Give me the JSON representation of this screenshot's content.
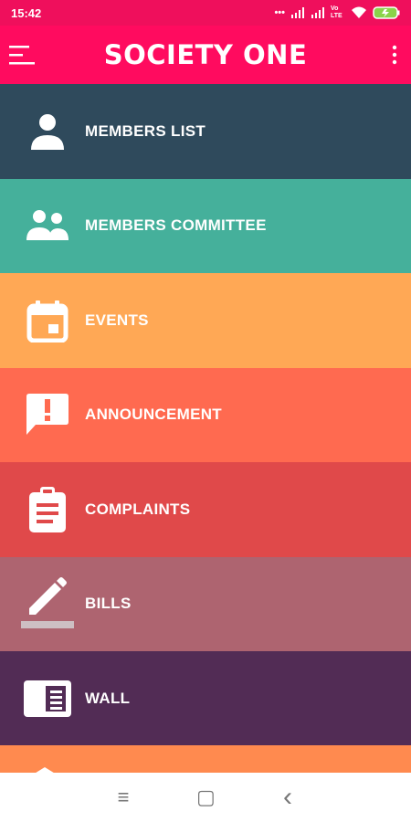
{
  "status": {
    "time": "15:42",
    "dots": "•••",
    "volte": "Vo LTE"
  },
  "app": {
    "title": "SOCIETY ONE"
  },
  "menu": [
    {
      "label": "MEMBERS LIST",
      "color": "#2f4a5c",
      "icon": "person-icon"
    },
    {
      "label": "MEMBERS COMMITTEE",
      "color": "#45b09b",
      "icon": "group-icon"
    },
    {
      "label": "EVENTS",
      "color": "#ffa855",
      "icon": "calendar-icon"
    },
    {
      "label": "ANNOUNCEMENT",
      "color": "#ff6a50",
      "icon": "announcement-icon"
    },
    {
      "label": "COMPLAINTS",
      "color": "#e0494a",
      "icon": "clipboard-icon"
    },
    {
      "label": "BILLS",
      "color": "#ae6470",
      "icon": "pencil-icon"
    },
    {
      "label": "WALL",
      "color": "#522c55",
      "icon": "wall-icon"
    }
  ],
  "colors": {
    "accent": "#ff0b5f",
    "peek": "#ff8a4f"
  },
  "nav": {
    "recent_icon": "≡",
    "home_icon": "▢",
    "back_icon": "‹"
  }
}
